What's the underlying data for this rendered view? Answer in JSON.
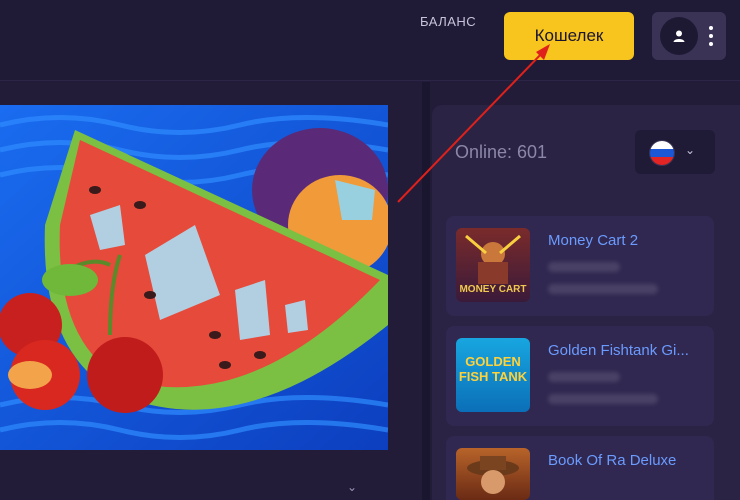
{
  "header": {
    "balance_label": "БАЛАНС",
    "wallet_button": "Кошелек"
  },
  "sidebar": {
    "online_text": "Online: 601",
    "language_flag": "russia-flag-icon",
    "games": [
      {
        "title": "Money Cart 2",
        "thumb_text": "MONEY CART"
      },
      {
        "title": "Golden Fishtank Gi...",
        "thumb_text": "GOLDEN FISH TANK"
      },
      {
        "title": "Book Of Ra Deluxe",
        "thumb_text": ""
      }
    ]
  },
  "colors": {
    "accent_yellow": "#f7c51d",
    "link_blue": "#6b9bff",
    "background": "#221c39"
  }
}
